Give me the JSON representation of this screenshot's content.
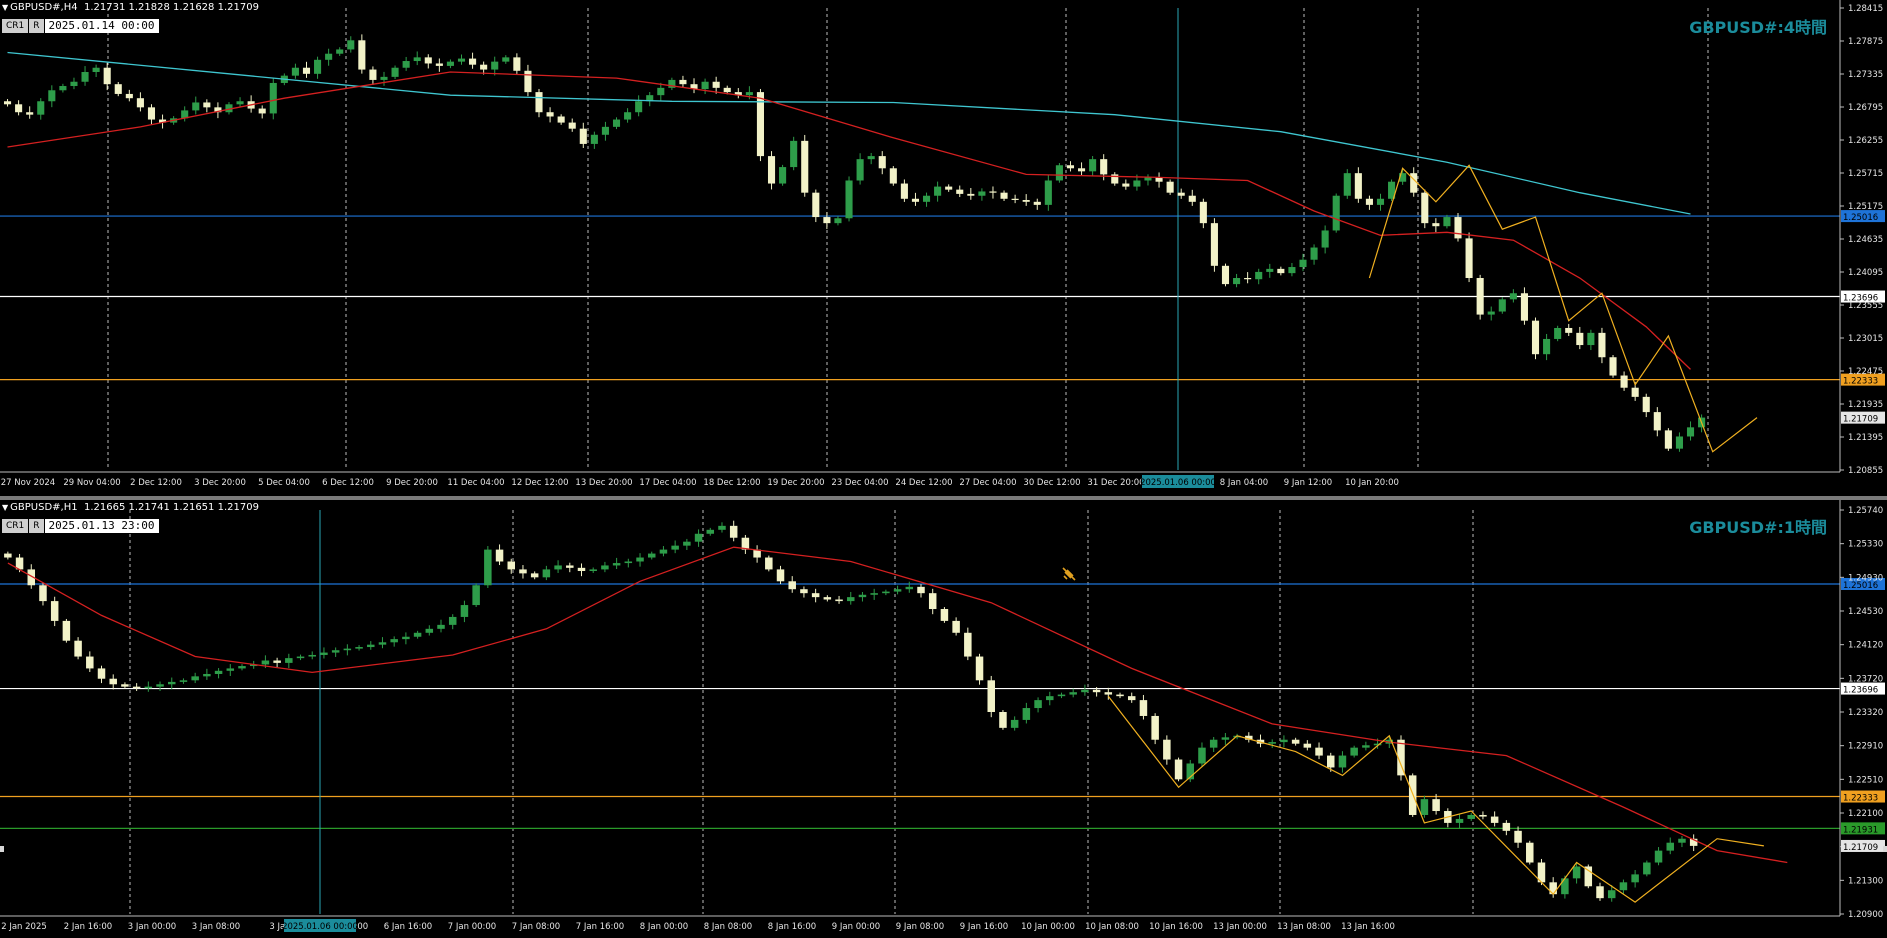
{
  "chart_data": [
    {
      "type": "candlestick",
      "symbol": "GBPUSD#",
      "timeframe": "H4",
      "ohlc_label": "1.21731 1.21828 1.21628 1.21709",
      "cursor_time": "2025.01.14 00:00",
      "controls": [
        "CR1",
        "R"
      ],
      "watermark": "GBPUSD#:4時間",
      "ylim": [
        1.2085,
        1.2843
      ],
      "y_ticks": [
        "1.28415",
        "1.27875",
        "1.27335",
        "1.26795",
        "1.26255",
        "1.25715",
        "1.25175",
        "1.24635",
        "1.24095",
        "1.23555",
        "1.23015",
        "1.22475",
        "1.21935",
        "1.21395",
        "1.20855"
      ],
      "x_ticks": [
        "27 Nov 2024",
        "29 Nov 04:00",
        "2 Dec 12:00",
        "3 Dec 20:00",
        "5 Dec 04:00",
        "6 Dec 12:00",
        "9 Dec 20:00",
        "11 Dec 04:00",
        "12 Dec 12:00",
        "13 Dec 20:00",
        "17 Dec 04:00",
        "18 Dec 12:00",
        "19 Dec 20:00",
        "23 Dec 04:00",
        "24 Dec 12:00",
        "27 Dec 04:00",
        "30 Dec 12:00",
        "31 Dec 20:00",
        "6 Jan 20:00",
        "8 Jan 04:00",
        "9 Jan 12:00",
        "10 Jan 20:00"
      ],
      "crosshair_time_label": "2025.01.06 00:00",
      "hlines": [
        {
          "price": 1.25016,
          "label": "1.25016",
          "color": "#1e73d8"
        },
        {
          "price": 1.23696,
          "label": "1.23696",
          "color": "#ffffff"
        },
        {
          "price": 1.22333,
          "label": "1.22333",
          "color": "#f0a020"
        }
      ],
      "last_price": {
        "price": 1.21709,
        "label": "1.21709"
      },
      "closes": [
        1.2685,
        1.2672,
        1.2668,
        1.269,
        1.2708,
        1.2715,
        1.2722,
        1.2738,
        1.2745,
        1.2718,
        1.2702,
        1.2695,
        1.268,
        1.266,
        1.2655,
        1.2662,
        1.2675,
        1.2688,
        1.268,
        1.2672,
        1.2685,
        1.269,
        1.2678,
        1.267,
        1.272,
        1.2732,
        1.2745,
        1.2735,
        1.2758,
        1.2768,
        1.2775,
        1.279,
        1.2742,
        1.2725,
        1.273,
        1.2745,
        1.2756,
        1.2762,
        1.2752,
        1.2748,
        1.2755,
        1.276,
        1.275,
        1.2742,
        1.2755,
        1.2762,
        1.274,
        1.2705,
        1.2672,
        1.2665,
        1.2655,
        1.2645,
        1.262,
        1.2635,
        1.2648,
        1.266,
        1.2672,
        1.269,
        1.27,
        1.2712,
        1.2725,
        1.2718,
        1.271,
        1.2722,
        1.2712,
        1.2705,
        1.27,
        1.2705,
        1.26,
        1.2555,
        1.2582,
        1.2625,
        1.254,
        1.25,
        1.249,
        1.2498,
        1.256,
        1.2595,
        1.26,
        1.258,
        1.2555,
        1.253,
        1.2525,
        1.2535,
        1.255,
        1.2545,
        1.2538,
        1.2535,
        1.2542,
        1.254,
        1.253,
        1.2528,
        1.2525,
        1.252,
        1.256,
        1.2585,
        1.258,
        1.2575,
        1.2595,
        1.257,
        1.2555,
        1.255,
        1.256,
        1.2565,
        1.2558,
        1.254,
        1.2535,
        1.2525,
        1.249,
        1.242,
        1.239,
        1.24,
        1.2398,
        1.241,
        1.2415,
        1.2408,
        1.2418,
        1.243,
        1.245,
        1.2478,
        1.2535,
        1.2572,
        1.253,
        1.252,
        1.253,
        1.2558,
        1.2572,
        1.254,
        1.249,
        1.2485,
        1.25,
        1.2465,
        1.24,
        1.234,
        1.2345,
        1.2365,
        1.2375,
        1.233,
        1.2275,
        1.23,
        1.2318,
        1.231,
        1.229,
        1.231,
        1.227,
        1.224,
        1.222,
        1.2205,
        1.218,
        1.215,
        1.212,
        1.214,
        1.2155,
        1.2171
      ],
      "ma_red": [
        [
          0,
          1.2615
        ],
        [
          12,
          1.2648
        ],
        [
          25,
          1.2695
        ],
        [
          40,
          1.2738
        ],
        [
          55,
          1.2728
        ],
        [
          68,
          1.2695
        ],
        [
          80,
          1.263
        ],
        [
          92,
          1.257
        ],
        [
          104,
          1.2565
        ],
        [
          112,
          1.256
        ],
        [
          118,
          1.251
        ],
        [
          124,
          1.247
        ],
        [
          130,
          1.2475
        ],
        [
          136,
          1.2462
        ],
        [
          142,
          1.24
        ],
        [
          148,
          1.232
        ],
        [
          152,
          1.225
        ]
      ],
      "ma_cyan": [
        [
          0,
          1.277
        ],
        [
          20,
          1.2735
        ],
        [
          40,
          1.27
        ],
        [
          60,
          1.269
        ],
        [
          80,
          1.2688
        ],
        [
          100,
          1.2668
        ],
        [
          115,
          1.264
        ],
        [
          130,
          1.259
        ],
        [
          142,
          1.254
        ],
        [
          152,
          1.2505
        ]
      ],
      "zigzag": [
        [
          123,
          1.24
        ],
        [
          126,
          1.258
        ],
        [
          129,
          1.2525
        ],
        [
          132,
          1.2585
        ],
        [
          135,
          1.248
        ],
        [
          138,
          1.25
        ],
        [
          141,
          1.233
        ],
        [
          144,
          1.2375
        ],
        [
          147,
          1.2225
        ],
        [
          150,
          1.2305
        ],
        [
          154,
          1.2115
        ],
        [
          158,
          1.2171
        ]
      ]
    },
    {
      "type": "candlestick",
      "symbol": "GBPUSD#",
      "timeframe": "H1",
      "ohlc_label": "1.21665 1.21741 1.21651 1.21709",
      "cursor_time": "2025.01.13 23:00",
      "controls": [
        "CR1",
        "R"
      ],
      "watermark": "GBPUSD#:1時間",
      "ylim": [
        1.2085,
        1.2595
      ],
      "y_ticks": [
        "1.25740",
        "1.25330",
        "1.24930",
        "1.24530",
        "1.24120",
        "1.23720",
        "1.23320",
        "1.22910",
        "1.22510",
        "1.22100",
        "1.21700",
        "1.21300",
        "1.20900"
      ],
      "x_ticks": [
        "2 Jan 2025",
        "2 Jan 16:00",
        "3 Jan 00:00",
        "3 Jan 08:00",
        "3 Jan",
        "6 Jan 08:00",
        "6 Jan 16:00",
        "7 Jan 00:00",
        "7 Jan 08:00",
        "7 Jan 16:00",
        "8 Jan 00:00",
        "8 Jan 08:00",
        "8 Jan 16:00",
        "9 Jan 00:00",
        "9 Jan 08:00",
        "9 Jan 16:00",
        "10 Jan 00:00",
        "10 Jan 08:00",
        "10 Jan 16:00",
        "13 Jan 00:00",
        "13 Jan 08:00",
        "13 Jan 16:00"
      ],
      "crosshair_time_label": "2025.01.06 00:00",
      "hlines": [
        {
          "price": 1.25016,
          "label": "1.25016",
          "color": "#1e73d8"
        },
        {
          "price": 1.23696,
          "label": "1.23696",
          "color": "#ffffff"
        },
        {
          "price": 1.22333,
          "label": "1.22333",
          "color": "#f0a020"
        },
        {
          "price": 1.21931,
          "label": "1.21931",
          "color": "#2a9a2a"
        }
      ],
      "last_price": {
        "price": 1.21709,
        "label": "1.21709"
      },
      "closes": [
        1.2535,
        1.252,
        1.25,
        1.248,
        1.2455,
        1.243,
        1.241,
        1.2395,
        1.2382,
        1.2375,
        1.2372,
        1.237,
        1.2372,
        1.2375,
        1.2378,
        1.238,
        1.2385,
        1.2388,
        1.2392,
        1.2395,
        1.2398,
        1.24,
        1.2405,
        1.2402,
        1.2408,
        1.241,
        1.2412,
        1.2415,
        1.2418,
        1.242,
        1.2422,
        1.2425,
        1.2428,
        1.2432,
        1.2435,
        1.244,
        1.2445,
        1.245,
        1.246,
        1.2475,
        1.25,
        1.2545,
        1.253,
        1.252,
        1.2515,
        1.251,
        1.252,
        1.2525,
        1.2522,
        1.2518,
        1.252,
        1.2525,
        1.2528,
        1.253,
        1.2535,
        1.254,
        1.2545,
        1.255,
        1.2555,
        1.2565,
        1.257,
        1.2575,
        1.256,
        1.2545,
        1.2535,
        1.252,
        1.2505,
        1.2495,
        1.249,
        1.2485,
        1.2482,
        1.248,
        1.2485,
        1.2488,
        1.249,
        1.2492,
        1.2495,
        1.2498,
        1.249,
        1.247,
        1.2455,
        1.244,
        1.241,
        1.238,
        1.234,
        1.232,
        1.233,
        1.2345,
        1.2355,
        1.236,
        1.2362,
        1.2365,
        1.2368,
        1.2365,
        1.2362,
        1.236,
        1.2355,
        1.2335,
        1.2305,
        1.228,
        1.2255,
        1.2275,
        1.2295,
        1.2305,
        1.2308,
        1.231,
        1.2305,
        1.23,
        1.2302,
        1.2305,
        1.23,
        1.2295,
        1.2285,
        1.227,
        1.2285,
        1.2295,
        1.2298,
        1.23,
        1.2305,
        1.226,
        1.221,
        1.223,
        1.2215,
        1.22,
        1.2205,
        1.221,
        1.2208,
        1.22,
        1.219,
        1.2175,
        1.215,
        1.2125,
        1.211,
        1.213,
        1.2145,
        1.212,
        1.2105,
        1.2115,
        1.2125,
        1.2135,
        1.215,
        1.2165,
        1.2175,
        1.218,
        1.2171
      ],
      "ma_red": [
        [
          0,
          1.2528
        ],
        [
          8,
          1.2462
        ],
        [
          16,
          1.241
        ],
        [
          26,
          1.239
        ],
        [
          38,
          1.2412
        ],
        [
          46,
          1.2445
        ],
        [
          54,
          1.2505
        ],
        [
          62,
          1.2548
        ],
        [
          72,
          1.253
        ],
        [
          84,
          1.2478
        ],
        [
          96,
          1.2395
        ],
        [
          108,
          1.2325
        ],
        [
          118,
          1.2302
        ],
        [
          128,
          1.2285
        ],
        [
          138,
          1.222
        ],
        [
          146,
          1.2165
        ],
        [
          152,
          1.215
        ]
      ],
      "zigzag": [
        [
          94,
          1.236
        ],
        [
          100,
          1.2245
        ],
        [
          105,
          1.231
        ],
        [
          110,
          1.229
        ],
        [
          114,
          1.226
        ],
        [
          118,
          1.231
        ],
        [
          121,
          1.22
        ],
        [
          125,
          1.2215
        ],
        [
          132,
          1.211
        ],
        [
          134,
          1.215
        ],
        [
          139,
          1.21
        ],
        [
          146,
          1.218
        ],
        [
          150,
          1.2171
        ]
      ]
    }
  ]
}
